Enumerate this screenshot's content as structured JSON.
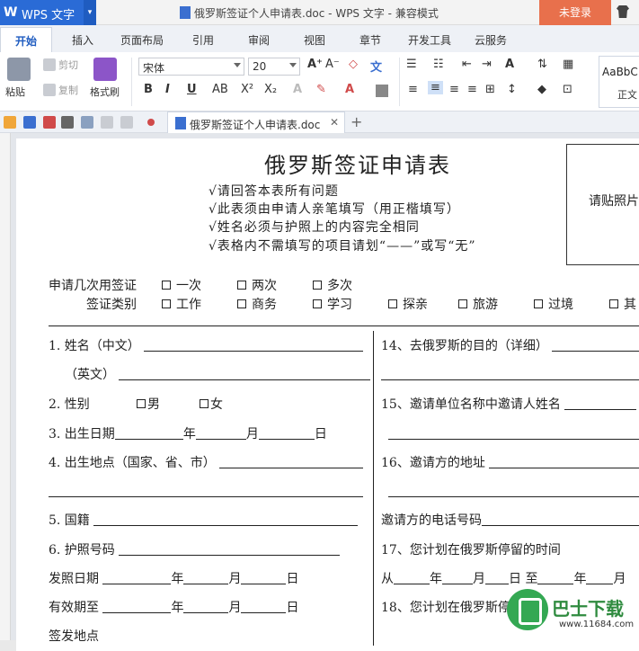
{
  "app": {
    "wps_label": "WPS 文字",
    "title": "俄罗斯签证个人申请表.doc - WPS 文字 - 兼容模式",
    "login": "未登录"
  },
  "tabs": [
    "开始",
    "插入",
    "页面布局",
    "引用",
    "审阅",
    "视图",
    "章节",
    "开发工具",
    "云服务"
  ],
  "ribbon": {
    "paste": "粘贴",
    "cut": "剪切",
    "copy": "复制",
    "format_painter": "格式刷",
    "font_name": "宋体",
    "font_size": "20",
    "style_sample": "AaBbC",
    "style_name": "正文"
  },
  "doc_tab": {
    "name": "俄罗斯签证个人申请表.doc"
  },
  "form": {
    "title": "俄罗斯签证申请表",
    "notes": [
      "√请回答本表所有问题",
      "√此表须由申请人亲笔填写（用正楷填写）",
      "√姓名必须与护照上的内容完全相同",
      "√表格内不需填写的项目请划“——”或写“无”"
    ],
    "photo_label": "请贴照片",
    "entry_label": "申请几次用签证",
    "entry_options": [
      "一次",
      "两次",
      "多次"
    ],
    "visa_type_label": "签证类别",
    "visa_type_options": [
      "工作",
      "商务",
      "学习",
      "探亲",
      "旅游",
      "过境",
      "其"
    ],
    "left": {
      "name_cn": "1. 姓名（中文）",
      "name_en": "（英文）",
      "gender": "2. 性别",
      "male": "男",
      "female": "女",
      "birth": "3. 出生日期",
      "year": "年",
      "month": "月",
      "day": "日",
      "birthplace": "4. 出生地点（国家、省、市）",
      "nationality": "5. 国籍",
      "passport": "6. 护照号码",
      "issue_date": "发照日期",
      "expiry": "有效期至",
      "issue_place": "签发地点"
    },
    "right": {
      "q14": "14、去俄罗斯的目的（详细）",
      "q15": "15、邀请单位名称中邀请人姓名",
      "q16": "16、邀请方的地址",
      "phone": "邀请方的电话号码",
      "q17": "17、您计划在俄罗斯停留的时间",
      "from": "从",
      "to": "至",
      "year": "年",
      "month": "月",
      "day": "日",
      "q18": "18、您计划在俄罗斯停"
    }
  },
  "watermark": {
    "text": "巴士下载",
    "url": "www.11684.com"
  }
}
